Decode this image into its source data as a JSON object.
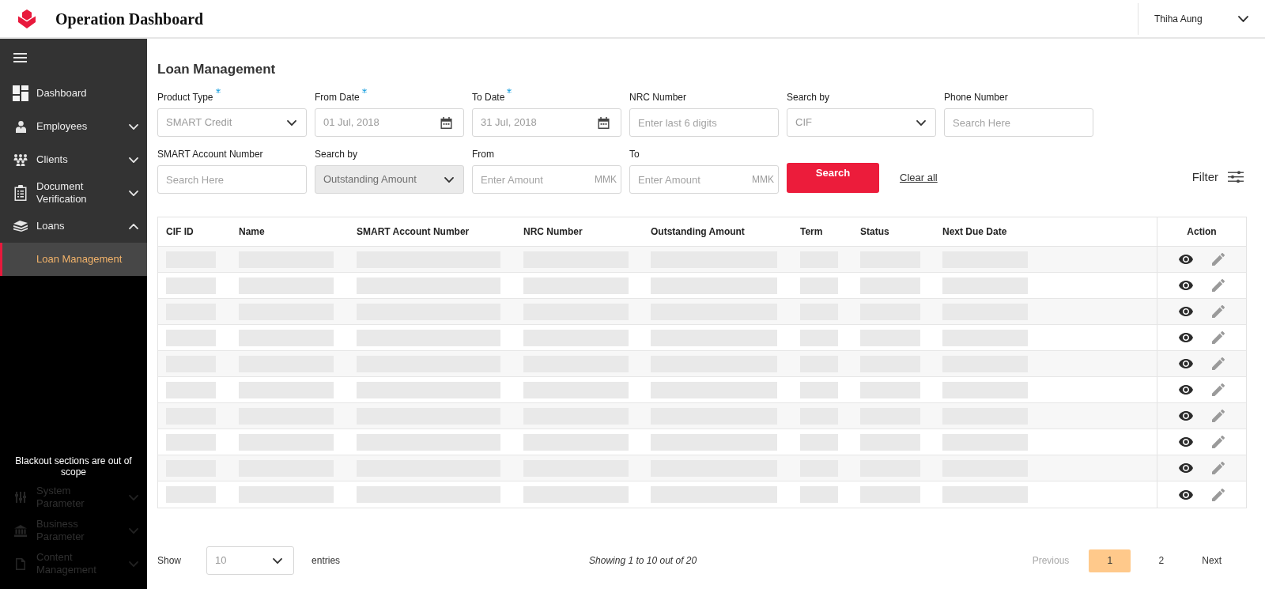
{
  "header": {
    "title": "Operation Dashboard",
    "user": "Thiha Aung"
  },
  "sidebar": {
    "items": [
      {
        "kind": "link",
        "label": "Dashboard",
        "disabled": false
      },
      {
        "kind": "group",
        "label": "Employees",
        "expanded": false,
        "disabled": false
      },
      {
        "kind": "group",
        "label": "Clients",
        "expanded": false,
        "disabled": false
      },
      {
        "kind": "group",
        "label": "Document Verification",
        "expanded": false,
        "disabled": false
      },
      {
        "kind": "group",
        "label": "Loans",
        "expanded": true,
        "disabled": false,
        "children": [
          {
            "label": "Loan Management",
            "selected": true
          }
        ]
      }
    ],
    "notice": "Blackout sections are out of scope",
    "blackout_items": [
      {
        "kind": "group",
        "label": "System Parameter",
        "expanded": false,
        "disabled": true
      },
      {
        "kind": "group",
        "label": "Business Parameter",
        "expanded": false,
        "disabled": true
      },
      {
        "kind": "group",
        "label": "Content Management",
        "expanded": false,
        "disabled": true
      }
    ]
  },
  "page_title": "Loan Management",
  "filter_rows": [
    {
      "fields": [
        {
          "kind": "select",
          "label": "Product Type",
          "required": true,
          "disabled": false,
          "value": "SMART Credit"
        },
        {
          "kind": "date",
          "label": "From Date",
          "required": true,
          "disabled": false,
          "value": "01 Jul, 2018"
        },
        {
          "kind": "date",
          "label": "To Date",
          "required": true,
          "disabled": false,
          "value": "31 Jul, 2018"
        },
        {
          "kind": "text",
          "label": "NRC Number",
          "required": false,
          "disabled": false,
          "placeholder": "Enter last 6 digits"
        },
        {
          "kind": "select",
          "label": "Search by",
          "required": false,
          "disabled": false,
          "value": "CIF"
        },
        {
          "kind": "text",
          "label": "Phone Number",
          "required": false,
          "disabled": false,
          "placeholder": "Search Here"
        }
      ]
    },
    {
      "fields": [
        {
          "kind": "text",
          "label": "SMART Account Number",
          "required": false,
          "disabled": false,
          "placeholder": "Search Here"
        },
        {
          "kind": "select",
          "label": "Search by",
          "required": false,
          "disabled": true,
          "value": "Outstanding Amount"
        },
        {
          "kind": "amount",
          "label": "From",
          "required": false,
          "disabled": false,
          "placeholder": "Enter Amount",
          "suffix": "MMK"
        },
        {
          "kind": "amount",
          "label": "To",
          "required": false,
          "disabled": false,
          "placeholder": "Enter Amount",
          "suffix": "MMK"
        }
      ]
    }
  ],
  "search_button": "Search",
  "clear_all": "Clear all",
  "filter_button": "Filter",
  "table": {
    "columns": [
      "CIF ID",
      "Name",
      "SMART Account Number",
      "NRC Number",
      "Outstanding Amount",
      "Term",
      "Status",
      "Next Due Date",
      "Action"
    ],
    "rows": [
      {
        "kind": "placeholder"
      },
      {
        "kind": "placeholder"
      },
      {
        "kind": "placeholder"
      },
      {
        "kind": "placeholder"
      },
      {
        "kind": "placeholder"
      },
      {
        "kind": "placeholder"
      },
      {
        "kind": "placeholder"
      },
      {
        "kind": "placeholder"
      },
      {
        "kind": "placeholder"
      },
      {
        "kind": "placeholder"
      }
    ]
  },
  "pagination": {
    "show_label": "Show",
    "page_size": "10",
    "entries_label": "entries",
    "summary": "Showing 1 to 10 out of 20",
    "previous": {
      "label": "Previous",
      "disabled": true
    },
    "pages": [
      {
        "label": "1",
        "selected": true
      },
      {
        "label": "2",
        "selected": false
      }
    ],
    "next": {
      "label": "Next",
      "disabled": false
    }
  }
}
